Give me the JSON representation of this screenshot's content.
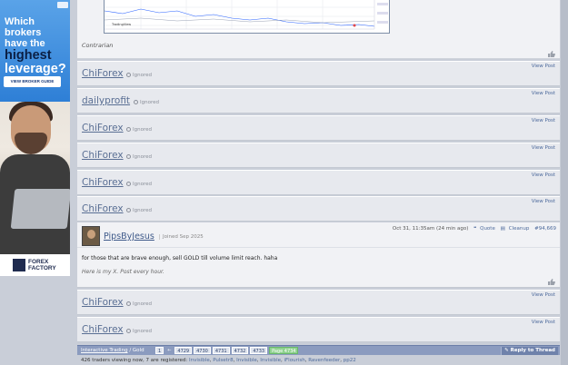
{
  "ad": {
    "line1": "Which brokers",
    "line2": "have the",
    "line3": "highest",
    "line4": "leverage?",
    "cta": "VIEW BROKER GUIDE",
    "brand_line1": "FOREX",
    "brand_line2": "FACTORY"
  },
  "chart_post": {
    "caption": "Contrarian",
    "chart_brand": "TradingView"
  },
  "ignored_label": "Ignored",
  "view_post_label": "View Post",
  "ignored_rows_top": [
    {
      "user": "ChiForex"
    },
    {
      "user": "dailyprofit"
    },
    {
      "user": "ChiForex"
    },
    {
      "user": "ChiForex"
    },
    {
      "user": "ChiForex"
    },
    {
      "user": "ChiForex"
    }
  ],
  "pips_post": {
    "user": "PipsByJesus",
    "joined": "Joined Sep 2025",
    "timestamp": "Oct 31, 11:35am (24 min ago)",
    "quote": "Quote",
    "cleanup": "Cleanup",
    "post_number": "#94,669",
    "body": "for those that are brave enough, sell GOLD till volume limit reach. haha",
    "signature": "Here is my X. Post every hour."
  },
  "ignored_rows_bottom": [
    {
      "user": "ChiForex"
    },
    {
      "user": "ChiForex"
    }
  ],
  "nav": {
    "crumb_link": "Interactive Trading",
    "crumb_sep": "/",
    "crumb_current": "Gold",
    "pages": [
      "1",
      "←",
      "4729",
      "4730",
      "4731",
      "4732",
      "4733",
      "Page 4734"
    ],
    "reply": "Reply to Thread"
  },
  "viewing": {
    "prefix": "426 traders viewing now, 7 are registered:",
    "users": [
      "Invisible",
      "Pulsetr8",
      "Invisible",
      "Invisible",
      "iFlourish",
      "Ravenfeeder",
      "pp22"
    ]
  }
}
